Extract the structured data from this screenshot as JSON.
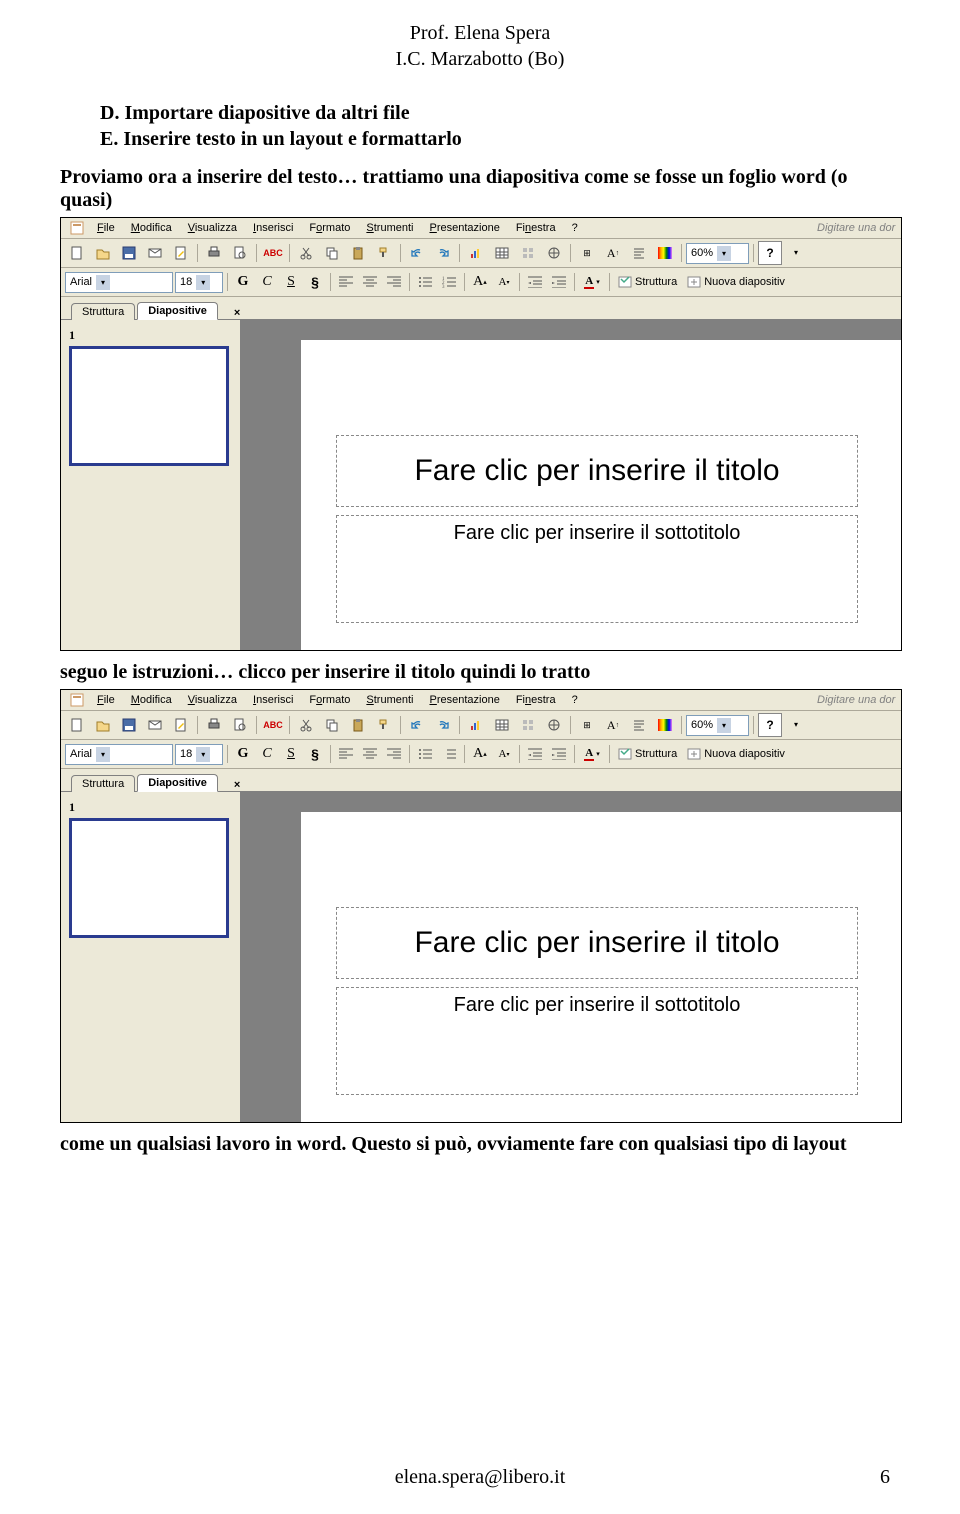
{
  "header": {
    "line1": "Prof. Elena Spera",
    "line2": "I.C. Marzabotto (Bo)"
  },
  "list": {
    "d": "D. Importare diapositive da altri file",
    "e": "E. Inserire testo in un layout e formattarlo"
  },
  "para1": "Proviamo ora a inserire del testo… trattiamo una diapositiva come se fosse un foglio word (o quasi)",
  "caption1": "seguo le istruzioni… clicco per inserire il titolo quindi lo tratto",
  "caption2": "come un qualsiasi lavoro in word. Questo si può, ovviamente fare con qualsiasi tipo di layout",
  "footer": {
    "email": "elena.spera@libero.it",
    "page": "6"
  },
  "app": {
    "menu": {
      "file": "File",
      "modifica": "Modifica",
      "visualizza": "Visualizza",
      "inserisci": "Inserisci",
      "formato": "Formato",
      "strumenti": "Strumenti",
      "presentazione": "Presentazione",
      "finestra": "Finestra",
      "help": "?",
      "search_hint": "Digitare una dor"
    },
    "toolbar2": {
      "font": "Arial",
      "size": "18",
      "zoom": "60%",
      "struttura": "Struttura",
      "nuova": "Nuova diapositiv"
    },
    "tabs": {
      "struttura": "Struttura",
      "diapositive": "Diapositive",
      "close": "×"
    },
    "slide": {
      "num": "1",
      "title_ph": "Fare clic per inserire il titolo",
      "sub_ph": "Fare clic per inserire il sottotitolo"
    }
  }
}
